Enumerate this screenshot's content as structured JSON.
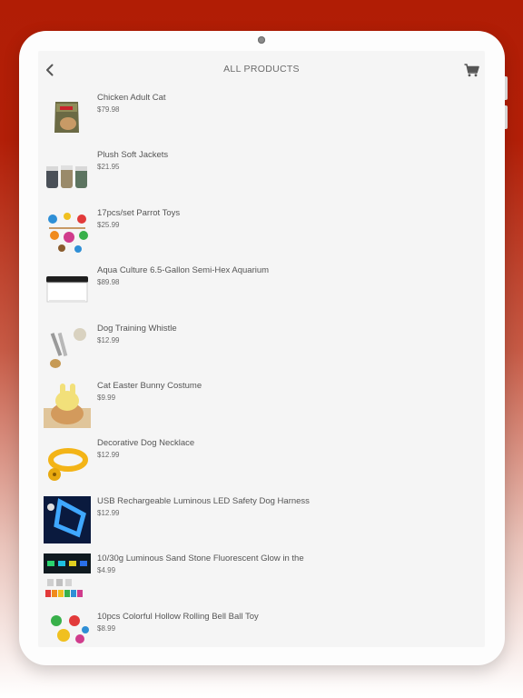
{
  "header": {
    "title": "ALL PRODUCTS",
    "back_icon": "chevron-left-icon",
    "cart_icon": "cart-icon"
  },
  "products": [
    {
      "name": "Chicken Adult Cat",
      "price": "$79.98"
    },
    {
      "name": "Plush Soft Jackets",
      "price": "$21.95"
    },
    {
      "name": "17pcs/set Parrot Toys",
      "price": "$25.99"
    },
    {
      "name": "Aqua Culture 6.5-Gallon Semi-Hex Aquarium",
      "price": "$89.98"
    },
    {
      "name": "Dog Training Whistle",
      "price": "$12.99"
    },
    {
      "name": "Cat Easter Bunny Costume",
      "price": "$9.99"
    },
    {
      "name": "Decorative Dog Necklace",
      "price": "$12.99"
    },
    {
      "name": "USB Rechargeable Luminous LED Safety Dog Harness",
      "price": "$12.99"
    },
    {
      "name": "10/30g Luminous Sand Stone Fluorescent Glow in the",
      "price": "$4.99"
    },
    {
      "name": "10pcs Colorful Hollow Rolling Bell Ball Toy",
      "price": "$8.99"
    }
  ],
  "colors": {
    "background_top": "#b11d05",
    "screen_bg": "#f5f5f5",
    "text": "#555555"
  }
}
